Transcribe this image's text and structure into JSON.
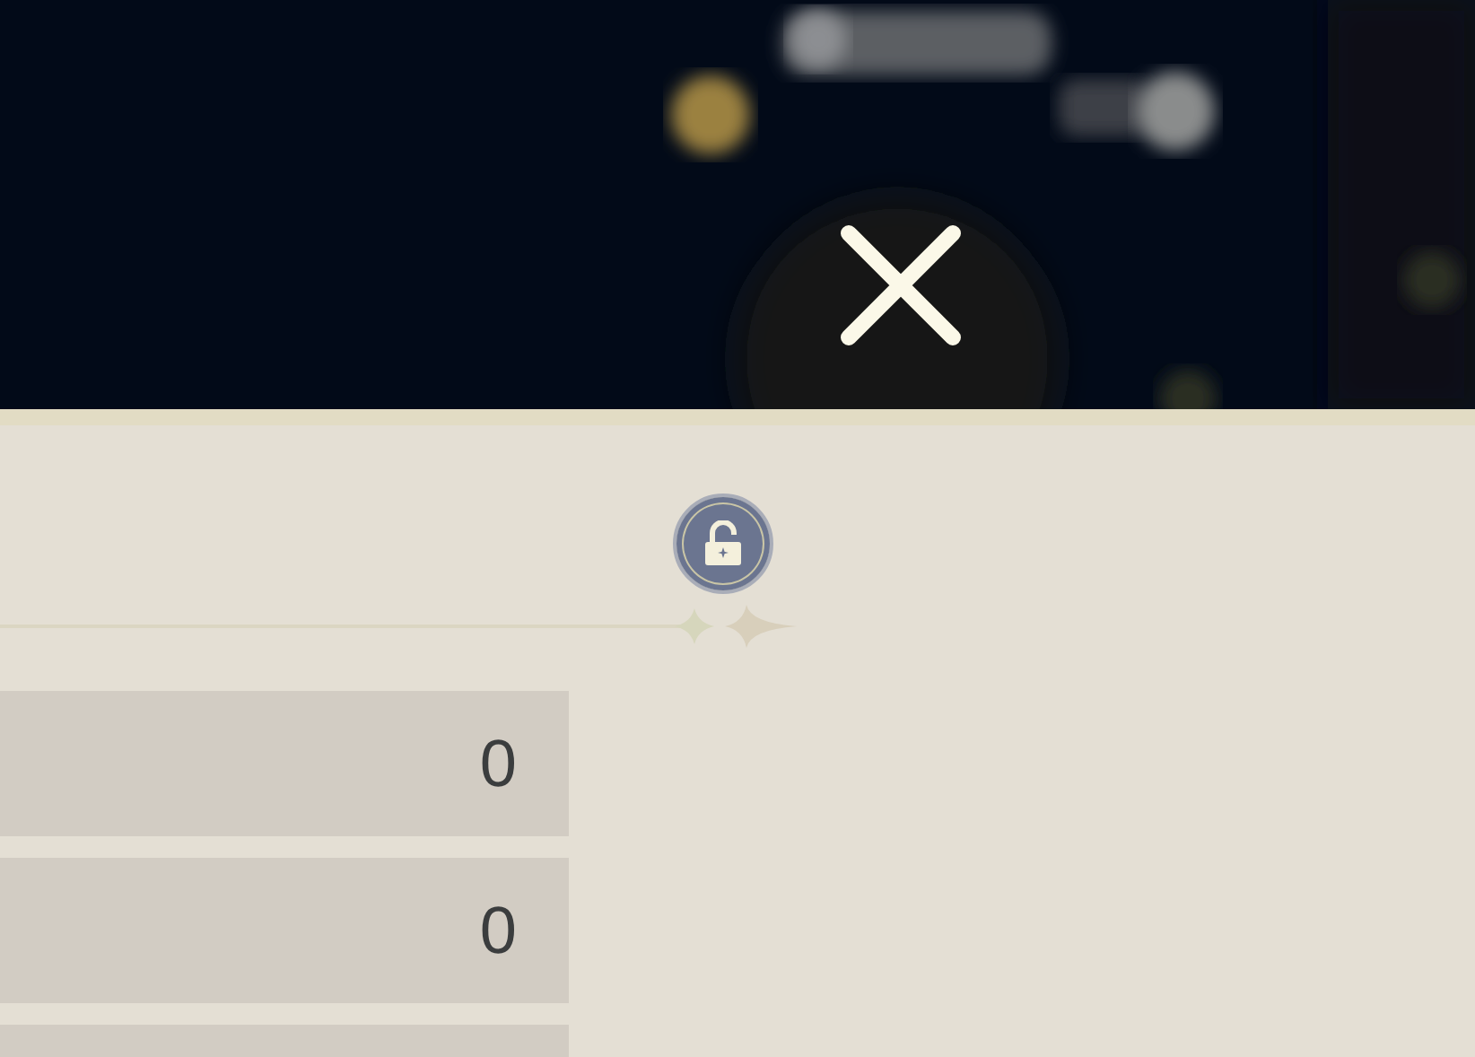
{
  "lock": {
    "locked": false
  },
  "stats": [
    {
      "kind": "value",
      "value": "0"
    },
    {
      "kind": "value",
      "value": "0"
    },
    {
      "kind": "blank"
    }
  ]
}
